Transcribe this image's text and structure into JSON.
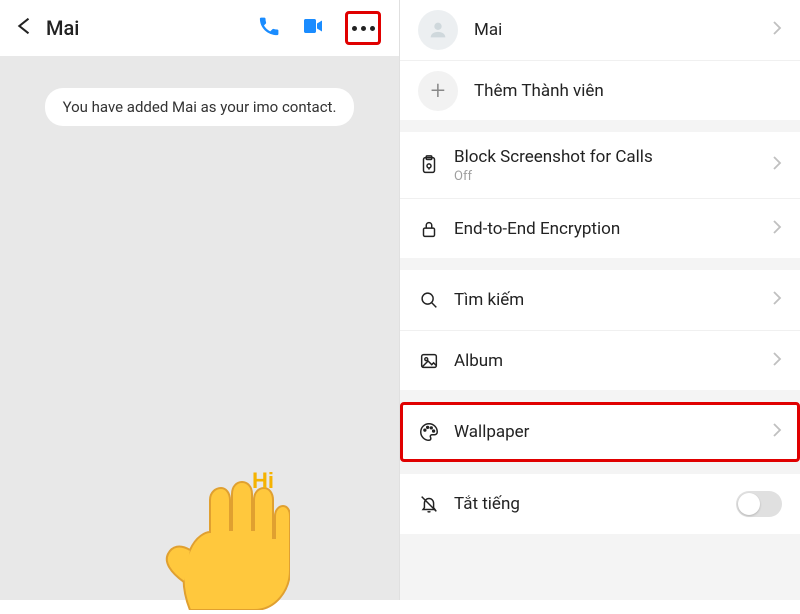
{
  "chat": {
    "title": "Mai",
    "system_message": "You have added Mai as your imo contact.",
    "sticker_text": "Hi"
  },
  "settings": {
    "contact_name": "Mai",
    "add_member": "Thêm Thành viên",
    "block_screenshot": {
      "label": "Block Screenshot for Calls",
      "status": "Off"
    },
    "encryption": "End-to-End Encryption",
    "search": "Tìm kiếm",
    "album": "Album",
    "wallpaper": "Wallpaper",
    "mute": "Tắt tiếng"
  }
}
